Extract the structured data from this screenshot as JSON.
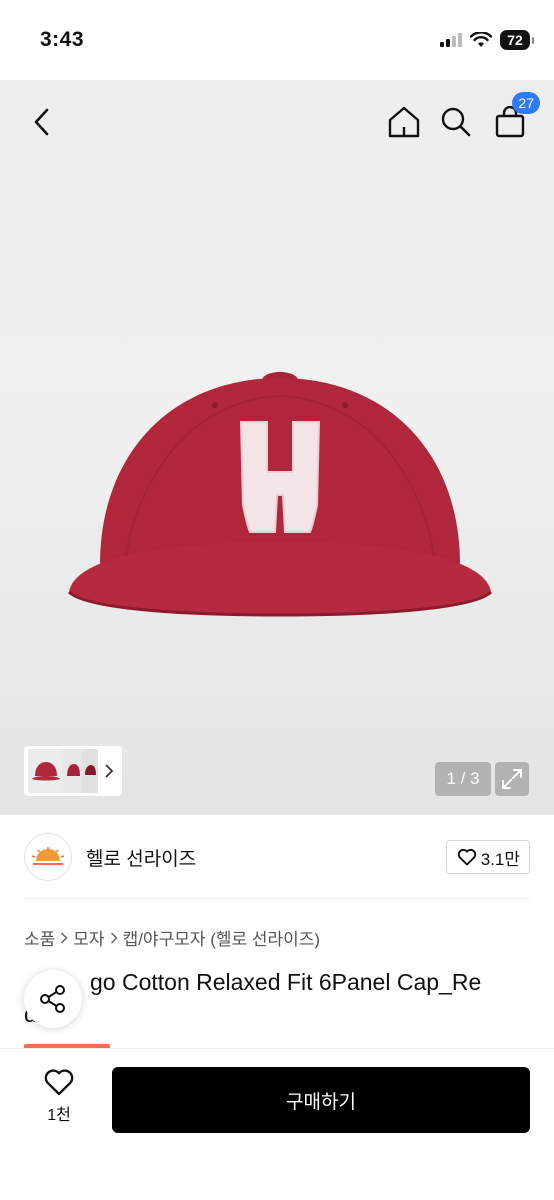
{
  "status_bar": {
    "time": "3:43",
    "battery": "72"
  },
  "nav": {
    "icons": [
      "back-icon",
      "home-icon",
      "search-icon",
      "shopping-bag-icon"
    ],
    "cart_count": "27"
  },
  "gallery": {
    "counter": "1 / 3"
  },
  "brand": {
    "name": "헬로 선라이즈",
    "like_count": "3.1만"
  },
  "breadcrumb": [
    "소품",
    "모자",
    "캡/야구모자 (헬로 선라이즈)"
  ],
  "product": {
    "title_visible": "go Cotton Relaxed Fit 6Panel Cap_Re",
    "title_line2": "d"
  },
  "bottom_bar": {
    "wish_count": "1천",
    "buy_label": "구매하기"
  },
  "colors": {
    "cap": "#b0263a",
    "badge": "#2f7bf5",
    "promo": "#f0704e",
    "buy_button": "#000000"
  }
}
